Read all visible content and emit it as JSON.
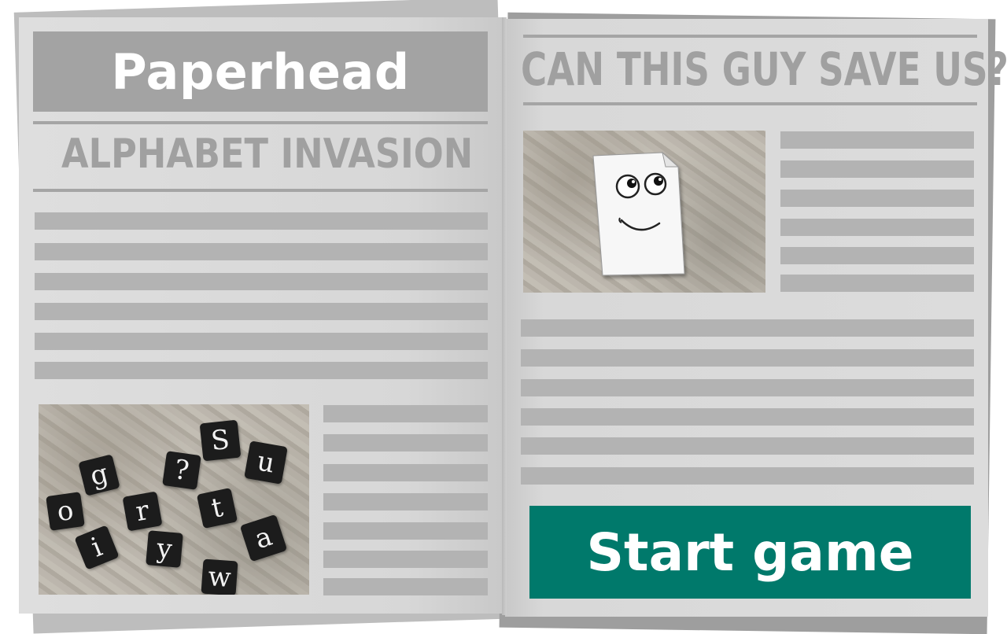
{
  "game": {
    "title": "Paperhead",
    "subtitle": "ALPHABET INVASION",
    "right_headline": "CAN THIS GUY SAVE US?",
    "start_button": "Start game"
  },
  "letter_tiles": [
    "g",
    "?",
    "S",
    "u",
    "o",
    "r",
    "t",
    "i",
    "y",
    "a",
    "w"
  ],
  "colors": {
    "title_box": "#a3a3a3",
    "headline_text": "#a0a0a0",
    "text_lines": "#b3b3b3",
    "start_button": "#00796b",
    "page": "#dcdcdc"
  },
  "icons": {
    "mascot": "paper-sheet-face-icon"
  }
}
